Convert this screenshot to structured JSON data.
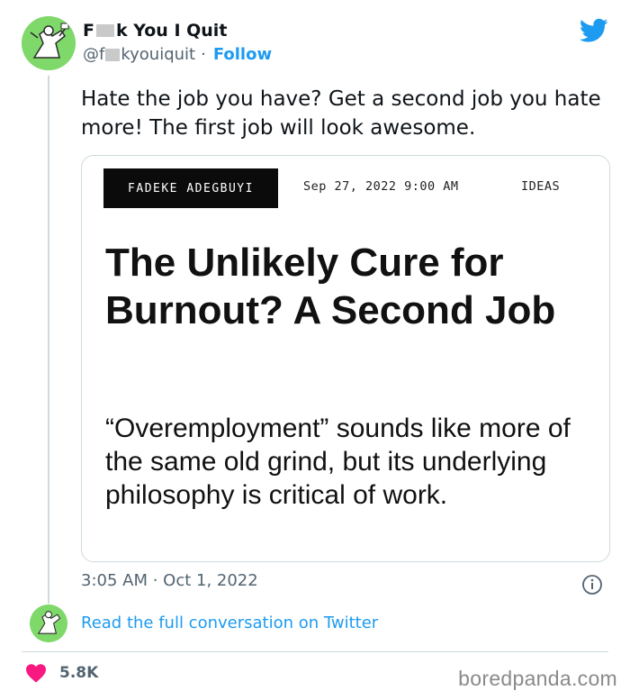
{
  "tweet": {
    "display_name_prefix": "F",
    "display_name_suffix": "k You I Quit",
    "handle_prefix": "@f",
    "handle_suffix": "kyouiquit",
    "separator": "·",
    "follow_label": "Follow",
    "text": "Hate the job you have? Get a second job you hate more! The first job will look awesome.",
    "timestamp": "3:05 AM · Oct 1, 2022",
    "read_full_label": "Read the full conversation on Twitter",
    "like_count": "5.8K"
  },
  "card": {
    "author": "FADEKE ADEGBUYI",
    "date": "Sep 27, 2022 9:00 AM",
    "section": "IDEAS",
    "headline": "The Unlikely Cure for Burnout? A Second Job",
    "dek": "“Overemployment” sounds like more of the same old grind, but its underlying philosophy is critical of work."
  },
  "watermark": "boredpanda.com",
  "colors": {
    "twitter_blue": "#1d9bf0",
    "heart_red": "#f91880",
    "avatar_green": "#7fd86a",
    "secondary_text": "#536471"
  },
  "icons": {
    "brand": "twitter-bird-icon",
    "info": "info-icon",
    "like": "heart-icon"
  }
}
